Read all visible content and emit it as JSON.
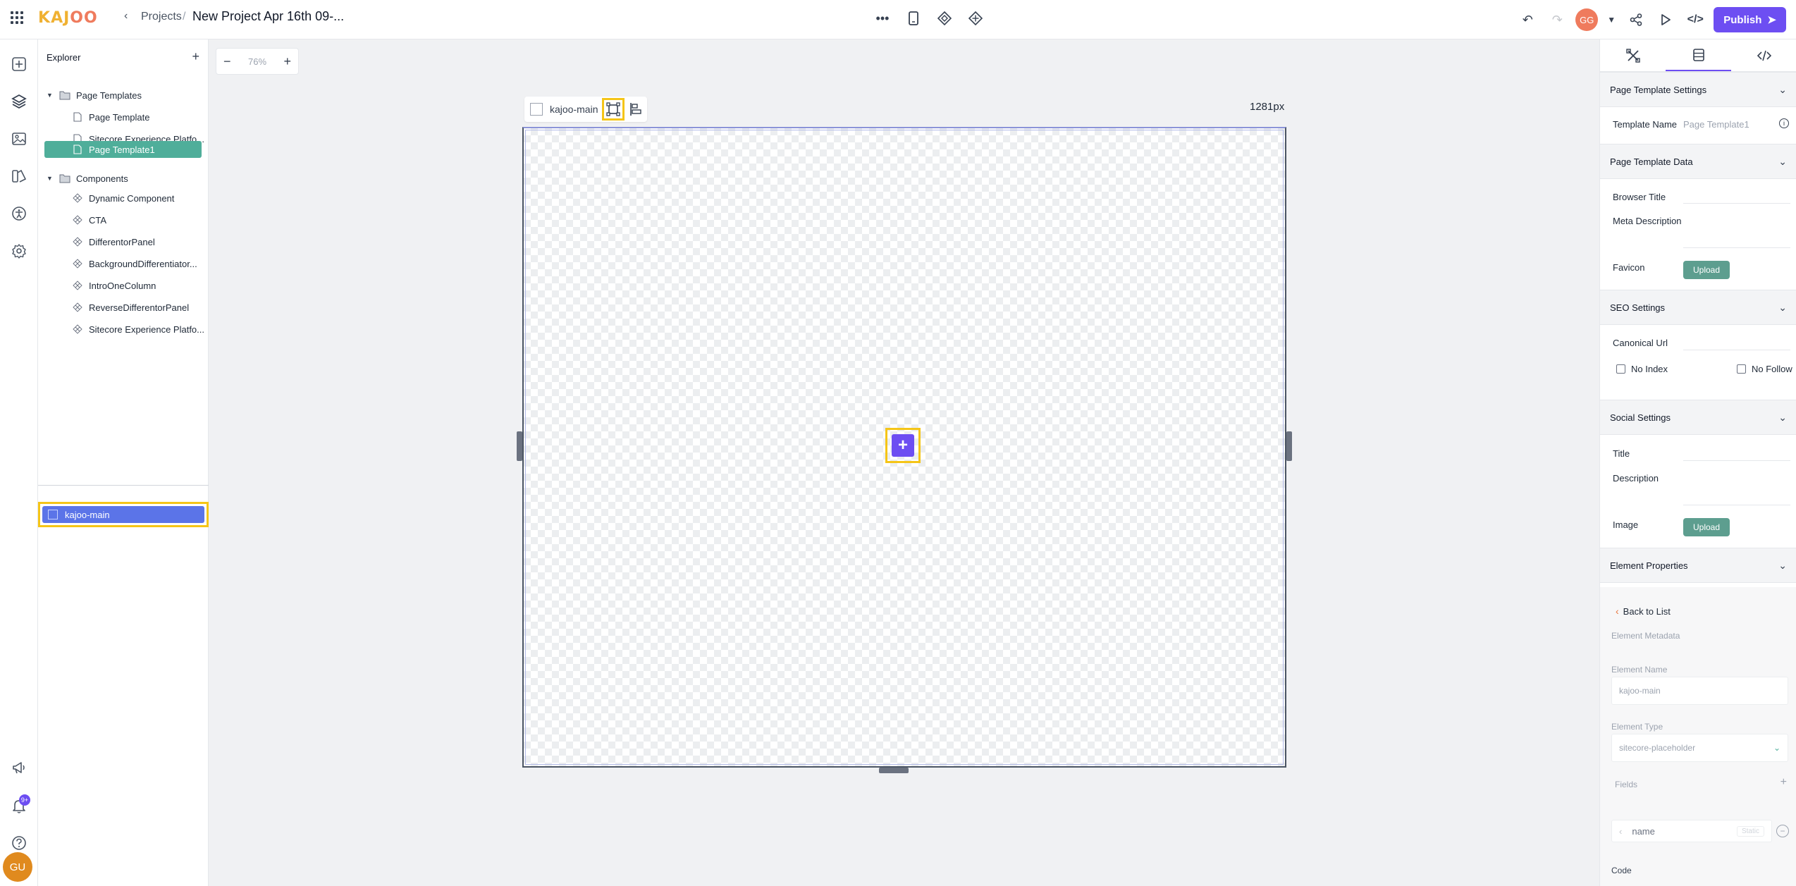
{
  "app": {
    "logo_letters": [
      "K",
      "A",
      "J",
      "O",
      "O"
    ],
    "logo_colors": [
      "#f0b132",
      "#f0b132",
      "#f0b132",
      "#ef7b5d",
      "#ef7b5d"
    ],
    "breadcrumb": "Projects",
    "breadcrumb_sep": "/",
    "project_title": "New Project Apr 16th 09-...",
    "user_initials": "GG",
    "publish_label": "Publish",
    "accent": "#6d4ef2"
  },
  "rail": {
    "notif_badge": "9+",
    "user_avatar": "GU"
  },
  "explorer": {
    "title": "Explorer",
    "groups": [
      {
        "label": "Page Templates",
        "items": [
          "Page Template",
          "Sitecore Experience Platfo...",
          "Page Template1"
        ]
      },
      {
        "label": "Components",
        "items": [
          "Dynamic Component",
          "CTA",
          "DifferentorPanel",
          "BackgroundDifferentiator...",
          "IntroOneColumn",
          "ReverseDifferentorPanel",
          "Sitecore Experience Platfo..."
        ]
      }
    ],
    "selected_item": "Page Template1",
    "layer": "kajoo-main"
  },
  "canvas": {
    "zoom": "76%",
    "element_name": "kajoo-main",
    "width_label": "1281px"
  },
  "panel": {
    "sections": {
      "page_template_settings": "Page Template Settings",
      "page_template_data": "Page Template Data",
      "seo_settings": "SEO Settings",
      "social_settings": "Social Settings",
      "element_properties": "Element Properties"
    },
    "template_name_label": "Template Name",
    "template_name_value": "Page Template1",
    "browser_title_label": "Browser Title",
    "meta_description_label": "Meta Description",
    "favicon_label": "Favicon",
    "upload_label": "Upload",
    "canonical_url_label": "Canonical Url",
    "no_index_label": "No Index",
    "no_follow_label": "No Follow",
    "social_title_label": "Title",
    "social_description_label": "Description",
    "image_label": "Image",
    "back_to_list": "Back to List",
    "element_metadata_label": "Element Metadata",
    "element_name_label": "Element Name",
    "element_name_value": "kajoo-main",
    "element_type_label": "Element Type",
    "element_type_value": "sitecore-placeholder",
    "fields_label": "Fields",
    "field_name": "name",
    "field_tag": "Static",
    "code_label": "Code"
  }
}
